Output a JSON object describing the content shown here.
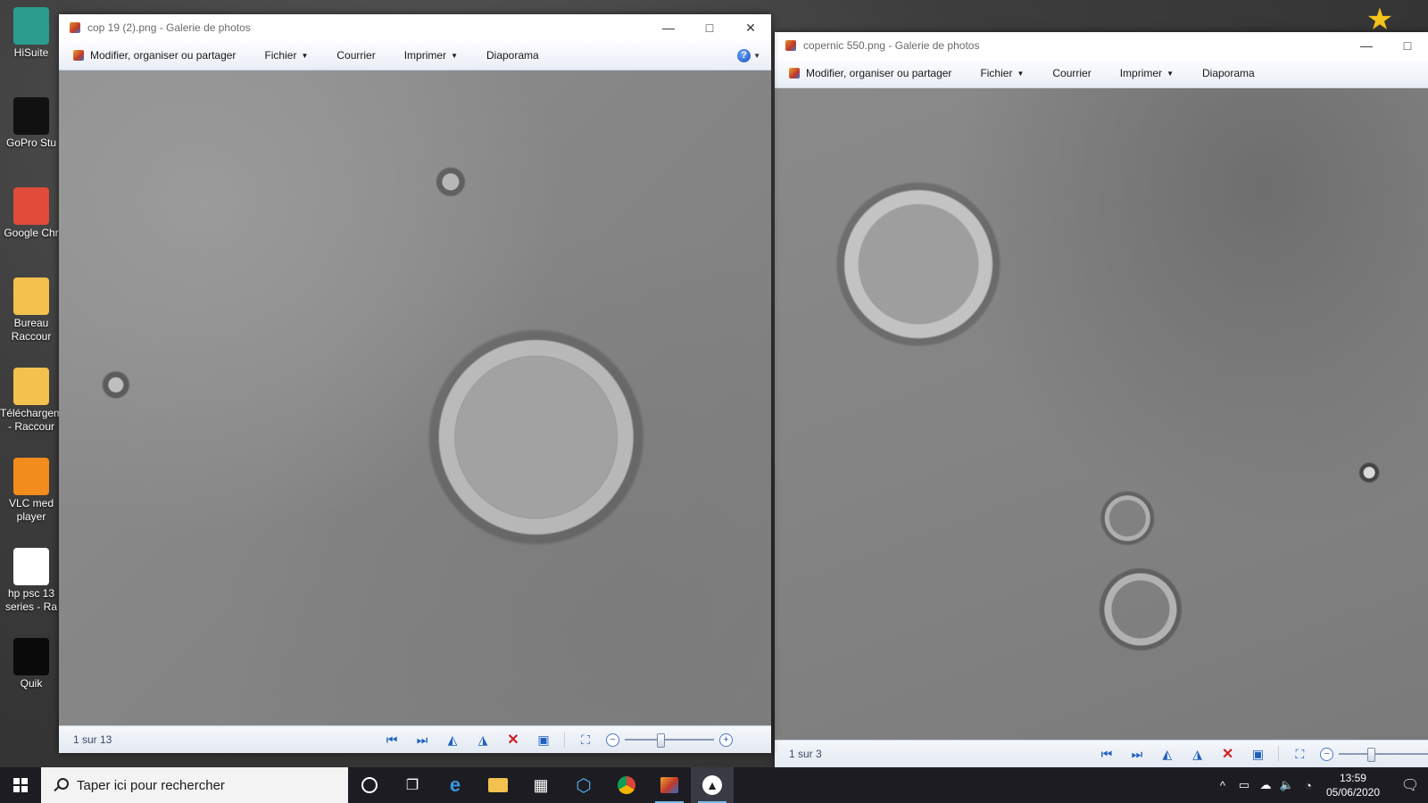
{
  "desktop": {
    "icons": [
      {
        "label": "HiSuite",
        "icon": "hisuite-icon",
        "color": "#2a9d8f"
      },
      {
        "label": "GoPro Stu",
        "icon": "gopro-studio-icon",
        "color": "#111111"
      },
      {
        "label": "Google Chr",
        "icon": "chrome-icon",
        "color": "#e04b3a"
      },
      {
        "label": "Bureau Raccour",
        "icon": "folder-icon",
        "color": "#f2c14e"
      },
      {
        "label": "Téléchargem - Raccour",
        "icon": "download-folder-icon",
        "color": "#f2c14e"
      },
      {
        "label": "VLC med player",
        "icon": "vlc-icon",
        "color": "#f28c1c"
      },
      {
        "label": "hp psc 13 series - Ra",
        "icon": "document-icon",
        "color": "#ffffff"
      },
      {
        "label": "Quik",
        "icon": "quik-icon",
        "color": "#0a0a0a"
      }
    ]
  },
  "window1": {
    "title": "cop 19 (2).png - Galerie de photos",
    "menu": {
      "organize": "Modifier, organiser ou partager",
      "file": "Fichier",
      "mail": "Courrier",
      "print": "Imprimer",
      "slideshow": "Diaporama",
      "help": "?"
    },
    "status": {
      "counter": "1 sur 13",
      "zoom_level": 0.4
    }
  },
  "window2": {
    "title": "copernic 550.png - Galerie de photos",
    "menu": {
      "organize": "Modifier, organiser ou partager",
      "file": "Fichier",
      "mail": "Courrier",
      "print": "Imprimer",
      "slideshow": "Diaporama"
    },
    "status": {
      "counter": "1 sur 3",
      "zoom_level": 0.35
    }
  },
  "taskbar": {
    "search_placeholder": "Taper ici pour rechercher",
    "time": "13:59",
    "date": "05/06/2020"
  },
  "colors": {
    "accent": "#1f5fbf",
    "taskbar": "#1c1c22",
    "delete": "#d02020"
  }
}
